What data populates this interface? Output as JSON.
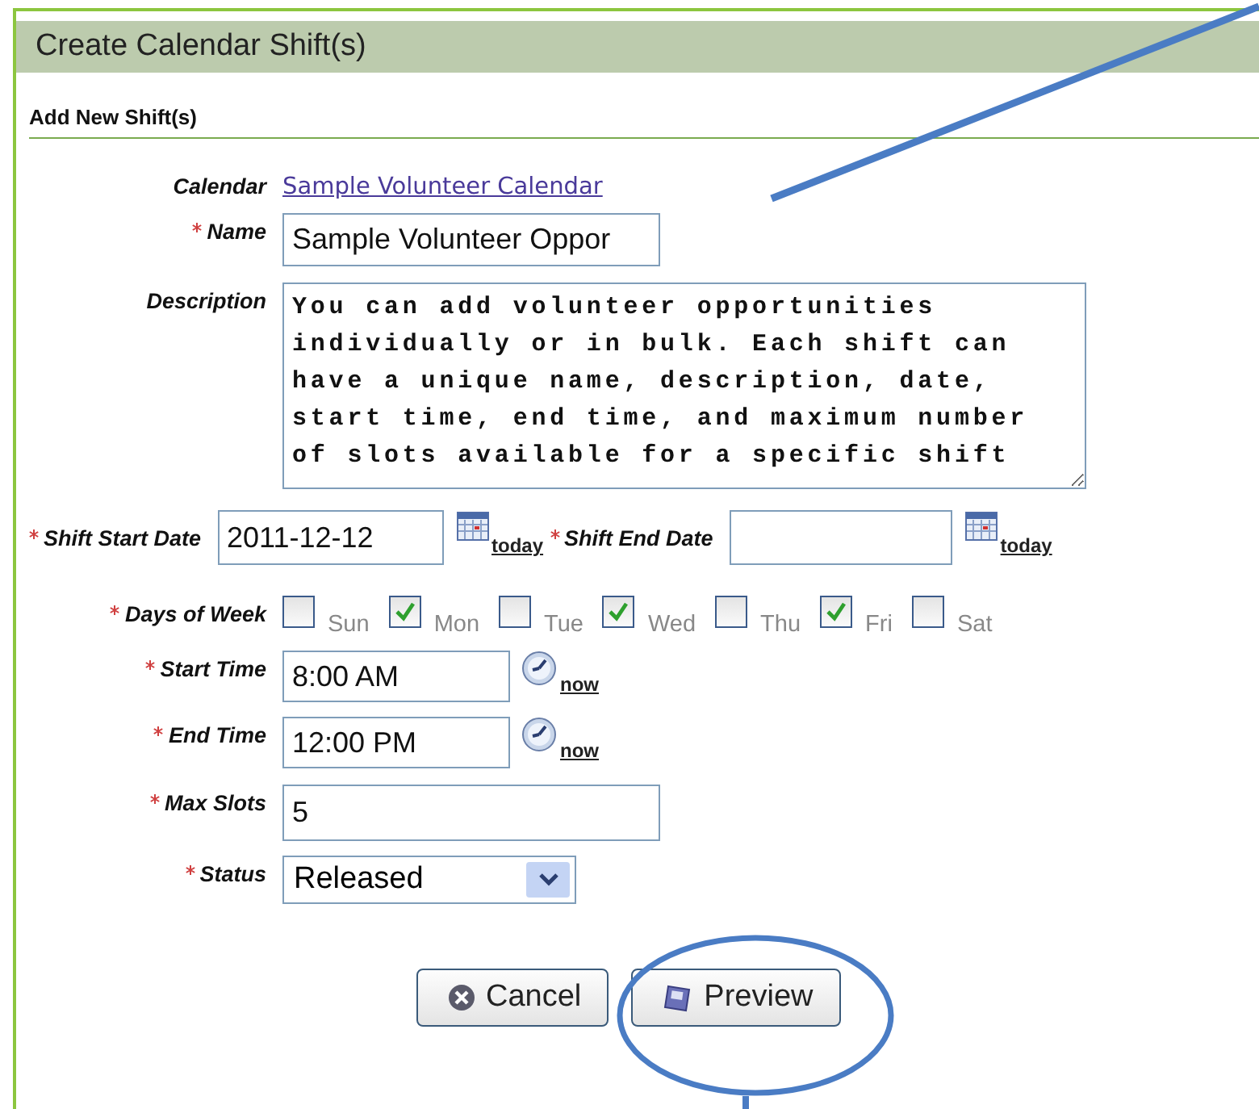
{
  "panel": {
    "title": "Create Calendar Shift(s)",
    "section": "Add New Shift(s)"
  },
  "fields": [
    {
      "kind": "link",
      "label": "Calendar",
      "required": false,
      "value": "Sample Volunteer Calendar"
    },
    {
      "kind": "text",
      "label": "Name",
      "required": true,
      "value": "Sample Volunteer Oppor"
    },
    {
      "kind": "textarea",
      "label": "Description",
      "required": false,
      "value": "You can add volunteer opportunities individually or in bulk. Each shift can have a unique name, description, date, start time, end time, and maximum number of slots available for a specific shift"
    },
    {
      "kind": "dates",
      "label": "Shift Start Date",
      "required": true,
      "value": "2011-12-12",
      "link": "today",
      "label2": "Shift End Date",
      "required2": true,
      "link2": "today"
    },
    {
      "kind": "days",
      "label": "Days of Week",
      "required": true,
      "days": [
        {
          "label": "Sun",
          "checked": false
        },
        {
          "label": "Mon",
          "checked": true
        },
        {
          "label": "Tue",
          "checked": false
        },
        {
          "label": "Wed",
          "checked": true
        },
        {
          "label": "Thu",
          "checked": false
        },
        {
          "label": "Fri",
          "checked": true
        },
        {
          "label": "Sat",
          "checked": false
        }
      ]
    },
    {
      "kind": "time",
      "label": "Start Time",
      "required": true,
      "value": "8:00 AM",
      "link": "now"
    },
    {
      "kind": "time",
      "label": "End Time",
      "required": true,
      "value": "12:00 PM",
      "link": "now"
    },
    {
      "kind": "text",
      "label": "Max Slots",
      "required": true,
      "value": "5"
    },
    {
      "kind": "select",
      "label": "Status",
      "required": true,
      "value": "Released"
    }
  ],
  "buttons": [
    {
      "kind": "cancel",
      "label": "Cancel"
    },
    {
      "kind": "preview",
      "label": "Preview"
    }
  ]
}
